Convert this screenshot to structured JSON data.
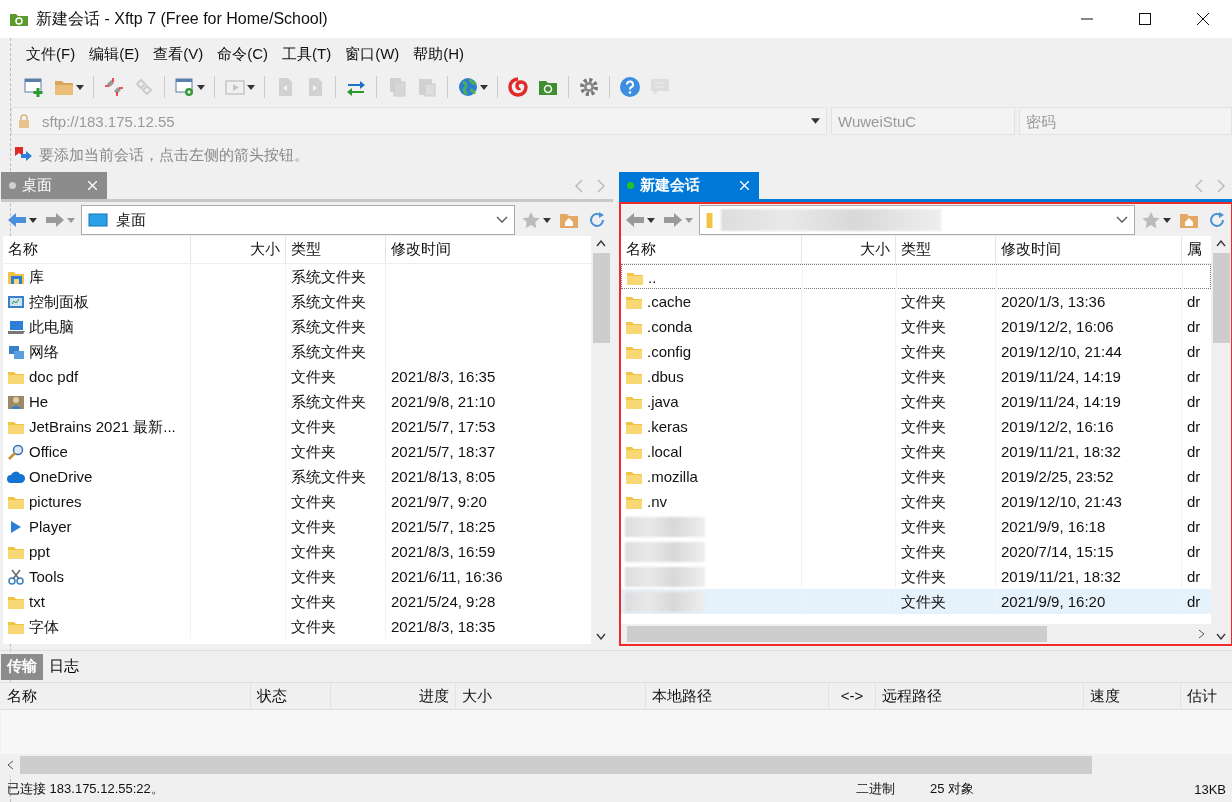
{
  "window": {
    "title": "新建会话 - Xftp 7 (Free for Home/School)"
  },
  "menu": [
    "文件(F)",
    "编辑(E)",
    "查看(V)",
    "命令(C)",
    "工具(T)",
    "窗口(W)",
    "帮助(H)"
  ],
  "toolbar": [
    {
      "kind": "new",
      "disabled": false,
      "dropdown": false
    },
    {
      "kind": "open",
      "disabled": false,
      "dropdown": true
    },
    {
      "kind": "separator"
    },
    {
      "kind": "disconnect",
      "disabled": false,
      "dropdown": false
    },
    {
      "kind": "link",
      "disabled": true,
      "dropdown": false
    },
    {
      "kind": "separator"
    },
    {
      "kind": "properties",
      "disabled": false,
      "dropdown": true
    },
    {
      "kind": "separator"
    },
    {
      "kind": "play",
      "disabled": true,
      "dropdown": true
    },
    {
      "kind": "separator"
    },
    {
      "kind": "upload",
      "disabled": true,
      "dropdown": false
    },
    {
      "kind": "download",
      "disabled": true,
      "dropdown": false
    },
    {
      "kind": "separator"
    },
    {
      "kind": "transfer",
      "disabled": false,
      "dropdown": false
    },
    {
      "kind": "separator"
    },
    {
      "kind": "copy",
      "disabled": true,
      "dropdown": false
    },
    {
      "kind": "paste",
      "disabled": true,
      "dropdown": false
    },
    {
      "kind": "separator"
    },
    {
      "kind": "globe",
      "disabled": false,
      "dropdown": true
    },
    {
      "kind": "separator"
    },
    {
      "kind": "swirl",
      "disabled": false,
      "dropdown": false
    },
    {
      "kind": "app",
      "disabled": false,
      "dropdown": false
    },
    {
      "kind": "separator"
    },
    {
      "kind": "settings",
      "disabled": false,
      "dropdown": false
    },
    {
      "kind": "separator"
    },
    {
      "kind": "help",
      "disabled": false,
      "dropdown": false
    },
    {
      "kind": "chat",
      "disabled": true,
      "dropdown": false
    }
  ],
  "address": {
    "url": "sftp://183.175.12.55",
    "user": "WuweiStuC",
    "password_placeholder": "密码"
  },
  "hint": "要添加当前会话，点击左侧的箭头按钮。",
  "panes": [
    {
      "tab": {
        "label": "桌面",
        "selected": false,
        "connected": false
      },
      "path": "桌面",
      "path_redacted": false,
      "frame": false,
      "columns": [
        "名称",
        "大小",
        "类型",
        "修改时间"
      ],
      "rows": [
        {
          "kind": "library",
          "name": "库",
          "size": "",
          "type": "系统文件夹",
          "modified": "",
          "selected": false
        },
        {
          "kind": "control-panel",
          "name": "控制面板",
          "size": "",
          "type": "系统文件夹",
          "modified": "",
          "selected": false
        },
        {
          "kind": "computer",
          "name": "此电脑",
          "size": "",
          "type": "系统文件夹",
          "modified": "",
          "selected": false
        },
        {
          "kind": "network",
          "name": "网络",
          "size": "",
          "type": "系统文件夹",
          "modified": "",
          "selected": false
        },
        {
          "kind": "folder",
          "name": "doc pdf",
          "size": "",
          "type": "文件夹",
          "modified": "2021/8/3, 16:35",
          "selected": false
        },
        {
          "kind": "user",
          "name": "He",
          "size": "",
          "type": "系统文件夹",
          "modified": "2021/9/8, 21:10",
          "selected": false
        },
        {
          "kind": "folder",
          "name": "JetBrains 2021 最新...",
          "size": "",
          "type": "文件夹",
          "modified": "2021/5/7, 17:53",
          "selected": false
        },
        {
          "kind": "search",
          "name": "Office",
          "size": "",
          "type": "文件夹",
          "modified": "2021/5/7, 18:37",
          "selected": false
        },
        {
          "kind": "cloud",
          "name": "OneDrive",
          "size": "",
          "type": "系统文件夹",
          "modified": "2021/8/13, 8:05",
          "selected": false
        },
        {
          "kind": "folder",
          "name": "pictures",
          "size": "",
          "type": "文件夹",
          "modified": "2021/9/7, 9:20",
          "selected": false
        },
        {
          "kind": "play",
          "name": "Player",
          "size": "",
          "type": "文件夹",
          "modified": "2021/5/7, 18:25",
          "selected": false
        },
        {
          "kind": "folder",
          "name": "ppt",
          "size": "",
          "type": "文件夹",
          "modified": "2021/8/3, 16:59",
          "selected": false
        },
        {
          "kind": "tools",
          "name": "Tools",
          "size": "",
          "type": "文件夹",
          "modified": "2021/6/11, 16:36",
          "selected": false
        },
        {
          "kind": "folder",
          "name": "txt",
          "size": "",
          "type": "文件夹",
          "modified": "2021/5/24, 9:28",
          "selected": false
        },
        {
          "kind": "folder",
          "name": "字体",
          "size": "",
          "type": "文件夹",
          "modified": "2021/8/3, 18:35",
          "selected": false
        }
      ]
    },
    {
      "tab": {
        "label": "新建会话",
        "selected": true,
        "connected": true
      },
      "path_redacted": true,
      "frame": true,
      "columns": [
        "名称",
        "大小",
        "类型",
        "修改时间",
        "属"
      ],
      "rows": [
        {
          "kind": "folder",
          "name": "..",
          "type": "",
          "modified": "",
          "attr": "",
          "selected": false
        },
        {
          "kind": "folder",
          "name": ".cache",
          "type": "文件夹",
          "modified": "2020/1/3, 13:36",
          "attr": "dr",
          "selected": false
        },
        {
          "kind": "folder",
          "name": ".conda",
          "type": "文件夹",
          "modified": "2019/12/2, 16:06",
          "attr": "dr",
          "selected": false
        },
        {
          "kind": "folder",
          "name": ".config",
          "type": "文件夹",
          "modified": "2019/12/10, 21:44",
          "attr": "dr",
          "selected": false
        },
        {
          "kind": "folder",
          "name": ".dbus",
          "type": "文件夹",
          "modified": "2019/11/24, 14:19",
          "attr": "dr",
          "selected": false
        },
        {
          "kind": "folder",
          "name": ".java",
          "type": "文件夹",
          "modified": "2019/11/24, 14:19",
          "attr": "dr",
          "selected": false
        },
        {
          "kind": "folder",
          "name": ".keras",
          "type": "文件夹",
          "modified": "2019/12/2, 16:16",
          "attr": "dr",
          "selected": false
        },
        {
          "kind": "folder",
          "name": ".local",
          "type": "文件夹",
          "modified": "2019/11/21, 18:32",
          "attr": "dr",
          "selected": false
        },
        {
          "kind": "folder",
          "name": ".mozilla",
          "type": "文件夹",
          "modified": "2019/2/25, 23:52",
          "attr": "dr",
          "selected": false
        },
        {
          "kind": "folder",
          "name": ".nv",
          "type": "文件夹",
          "modified": "2019/12/10, 21:43",
          "attr": "dr",
          "selected": false
        },
        {
          "kind": "redacted",
          "type": "文件夹",
          "modified": "2021/9/9, 16:18",
          "attr": "dr",
          "selected": false
        },
        {
          "kind": "redacted",
          "type": "文件夹",
          "modified": "2020/7/14, 15:15",
          "attr": "dr",
          "selected": false
        },
        {
          "kind": "redacted",
          "type": "文件夹",
          "modified": "2019/11/21, 18:32",
          "attr": "dr",
          "selected": false
        },
        {
          "kind": "redacted",
          "type": "文件夹",
          "modified": "2021/9/9, 16:20",
          "attr": "dr",
          "selected": true
        }
      ]
    }
  ],
  "bottom_tabs": [
    {
      "label": "传输",
      "selected": true
    },
    {
      "label": "日志",
      "selected": false
    }
  ],
  "transfer_columns": [
    "名称",
    "状态",
    "进度",
    "大小",
    "本地路径",
    "<->",
    "远程路径",
    "速度",
    "估计"
  ],
  "status_bar": {
    "connection": "已连接 183.175.12.55:22。",
    "mode": "二进制",
    "objects": "25 对象",
    "size": "13KB"
  }
}
